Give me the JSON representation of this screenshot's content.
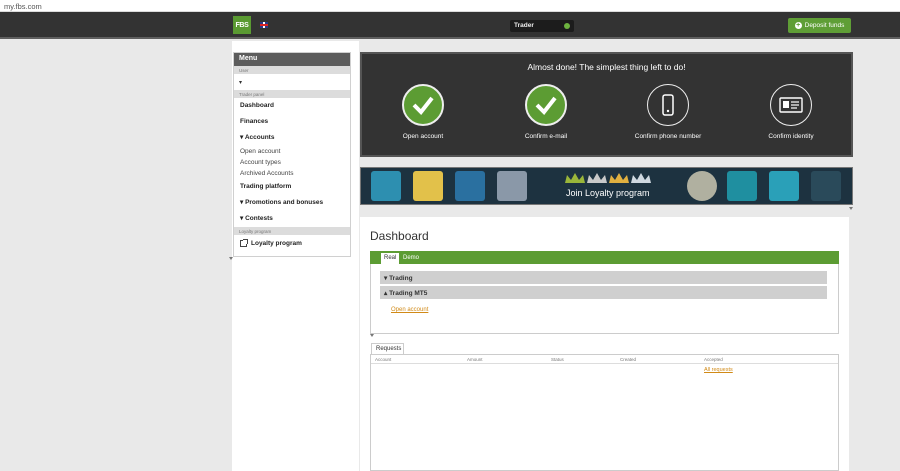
{
  "browser": {
    "url": "my.fbs.com"
  },
  "topbar": {
    "logo": "FBS",
    "role": "Trader",
    "deposit_label": "Deposit funds"
  },
  "menu": {
    "header": "Menu",
    "user_section": "User",
    "user_caret": "▾",
    "trader_section": "Trader panel",
    "dashboard": "Dashboard",
    "finances": "Finances",
    "accounts": "▾ Accounts",
    "open_account": "Open account",
    "account_types": "Account types",
    "archived_accounts": "Archived Accounts",
    "trading_platform": "Trading platform",
    "promotions": "▾ Promotions and bonuses",
    "contests": "▾ Contests",
    "loyalty_section": "Loyalty program",
    "loyalty_item": "Loyalty program"
  },
  "steps": {
    "title": "Almost done! The simplest thing left to do!",
    "items": [
      {
        "label": "Open account",
        "status": "done"
      },
      {
        "label": "Confirm e-mail",
        "status": "done"
      },
      {
        "label": "Confirm phone number",
        "status": "todo",
        "icon": "phone-icon"
      },
      {
        "label": "Confirm identity",
        "status": "todo",
        "icon": "id-card-icon"
      }
    ]
  },
  "banner": {
    "label": "Join Loyalty program"
  },
  "dashboard": {
    "title": "Dashboard",
    "tab_real": "Real",
    "tab_demo": "Demo",
    "row_trading": "▾ Trading",
    "row_mt5": "▴ Trading MT5",
    "open_account_link": "Open account"
  },
  "requests": {
    "tab": "Requests",
    "columns": [
      "Account",
      "Amount",
      "Status",
      "Created",
      "Accepted"
    ],
    "all_link": "All requests"
  },
  "colors": {
    "green": "#5c9c33",
    "dark": "#333333",
    "link": "#d18a17"
  }
}
